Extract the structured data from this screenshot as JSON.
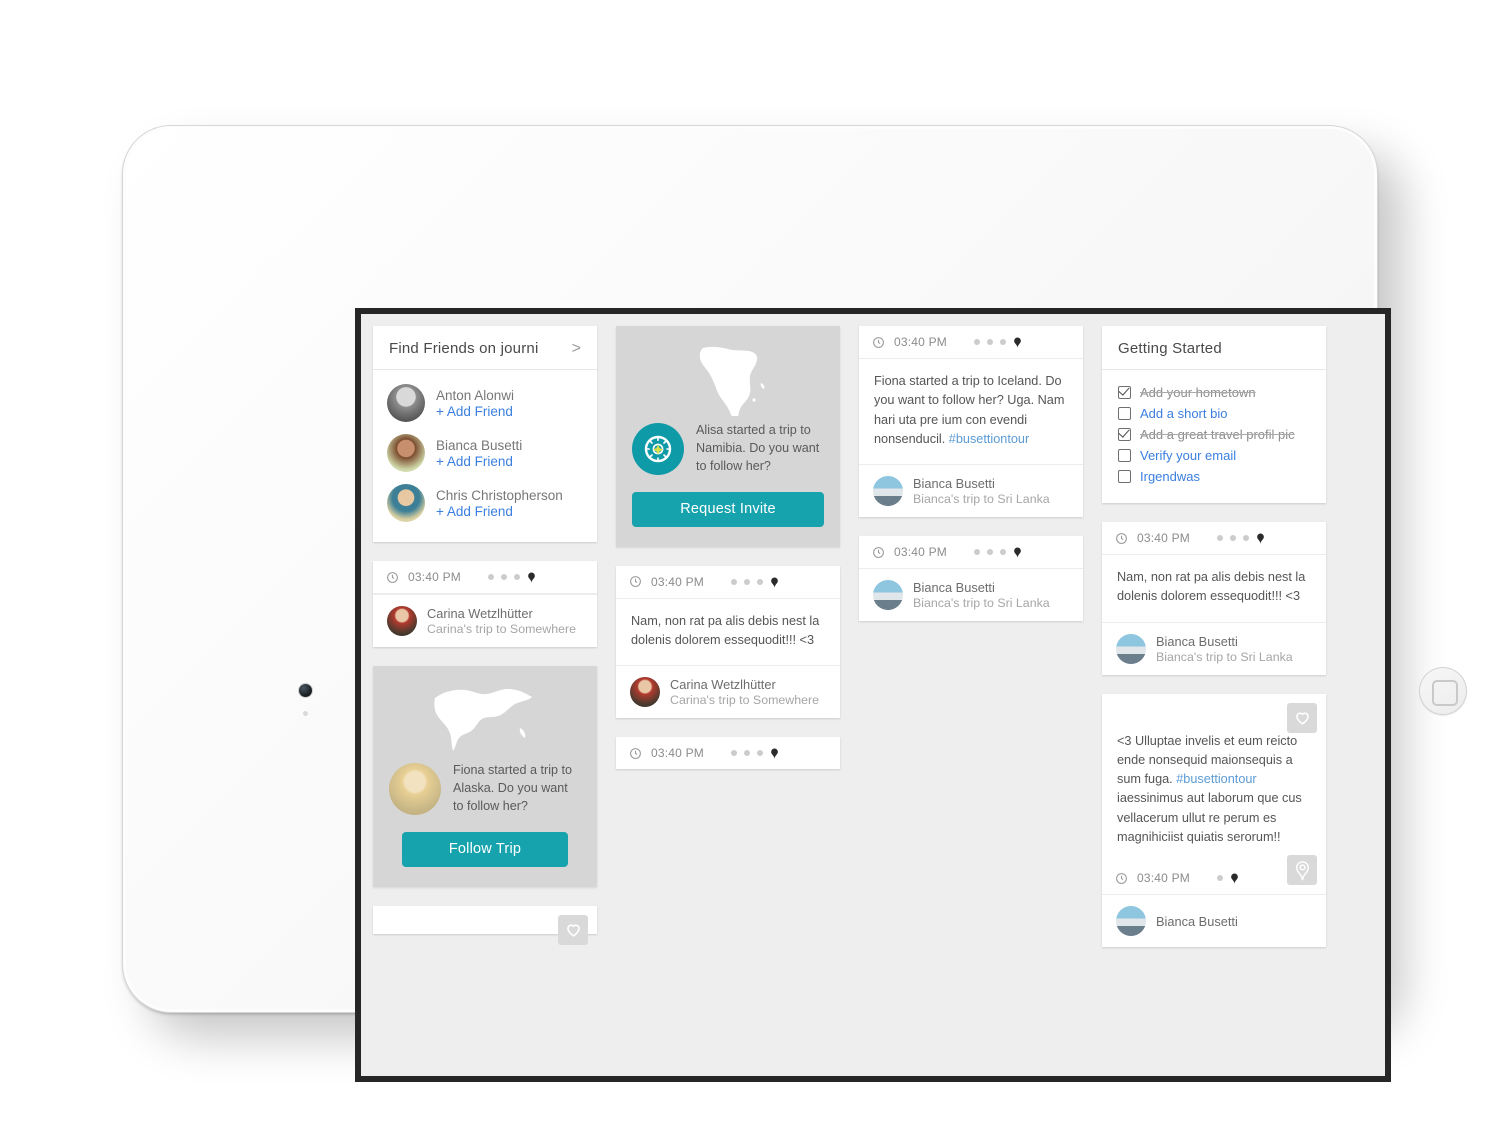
{
  "app": {
    "name": "journi"
  },
  "find_friends": {
    "title": "Find Friends on journi",
    "chevron": ">",
    "friends": [
      {
        "name": "Anton Alonwi",
        "action": "+ Add Friend",
        "avatar": "av-anton"
      },
      {
        "name": "Bianca Busetti",
        "action": "+ Add Friend",
        "avatar": "av-bianca"
      },
      {
        "name": "Chris Christopherson",
        "action": "+ Add Friend",
        "avatar": "av-chris"
      }
    ]
  },
  "invite_card": {
    "map_icon": "africa-map-icon",
    "promo_icon": "compass-icon",
    "text": "Alisa started a trip to Namibia.  Do you want to follow her?",
    "button": "Request Invite"
  },
  "follow_card": {
    "map_icon": "north-america-map-icon",
    "text": "Fiona started a trip to Alaska.  Do you want to follow her?",
    "button": "Follow Trip",
    "avatar": "av-fiona"
  },
  "getting_started": {
    "title": "Getting Started",
    "items": [
      {
        "label": "Add your hometown",
        "done": true
      },
      {
        "label": "Add a short bio",
        "done": false
      },
      {
        "label": "Add a great travel profil pic",
        "done": true
      },
      {
        "label": "Verify your email",
        "done": false
      },
      {
        "label": "Irgendwas",
        "done": false
      }
    ]
  },
  "posts": {
    "villa": {
      "badge": "bed-icon",
      "time": "03:40 PM",
      "dots": 4,
      "author": "Carina Wetzlhütter",
      "trip": "Carina's trip to Somewhere",
      "avatar": "av-carina"
    },
    "pool": {
      "badge": "beach-umbrella-icon",
      "time": "03:40 PM",
      "dots": 4,
      "text": "Nam, non rat pa alis debis nest la dolenis dolorem essequodit!!! <3",
      "author": "Carina Wetzlhütter",
      "trip": "Carina's trip to Somewhere",
      "avatar": "av-carina"
    },
    "fish": {
      "badge": "restaurant-icon",
      "time": "03:40 PM",
      "dots": 4
    },
    "ocean": {
      "badge": "tree-icon",
      "time": "03:40 PM",
      "dots": 4,
      "text_1": "Fiona started a trip to Iceland. Do you want to follow her? Uga. Nam hari uta pre ium con evendi nonsenducil. ",
      "hashtag": "#busettiontour",
      "author": "Bianca Busetti",
      "trip": "Bianca's trip to Sri Lanka",
      "avatar": "av-bianca2"
    },
    "bedroom": {
      "badge": "bed-icon",
      "time": "03:40 PM",
      "dots": 4,
      "author": "Bianca Busetti",
      "trip": "Bianca's trip to Sri Lanka",
      "avatar": "av-bianca2"
    },
    "woman": {
      "badge": "restaurant-icon"
    },
    "bird": {
      "badge": "flag-icon",
      "time": "03:40 PM",
      "dots": 4,
      "text": "Nam, non rat pa alis debis nest la dolenis dolorem essequodit!!! <3",
      "author": "Bianca Busetti",
      "trip": "Bianca's trip to Sri Lanka",
      "avatar": "av-bianca2"
    },
    "quote": {
      "text_1": "<3 Ulluptae invelis et eum reicto ende nonsequid maionsequis a sum fuga. ",
      "hashtag": "#busettiontour",
      "text_2": " iaessinimus aut laborum que cus vellacerum ullut re perum es magnihiciist quiatis serorum!!",
      "time": "03:40 PM",
      "dots": 2,
      "author": "Bianca Busetti",
      "avatar": "av-bianca2"
    }
  },
  "colors": {
    "teal": "#17a3ae",
    "link_blue": "#3b7fe0",
    "hashtag_blue": "#5b9bd5",
    "badge_bed": "#f5794f",
    "badge_beach": "#199ec9",
    "badge_green": "#8cc152",
    "badge_flag": "#f4a62a",
    "card_gray": "#d6d6d6",
    "screen_bg": "#eeeeee"
  }
}
